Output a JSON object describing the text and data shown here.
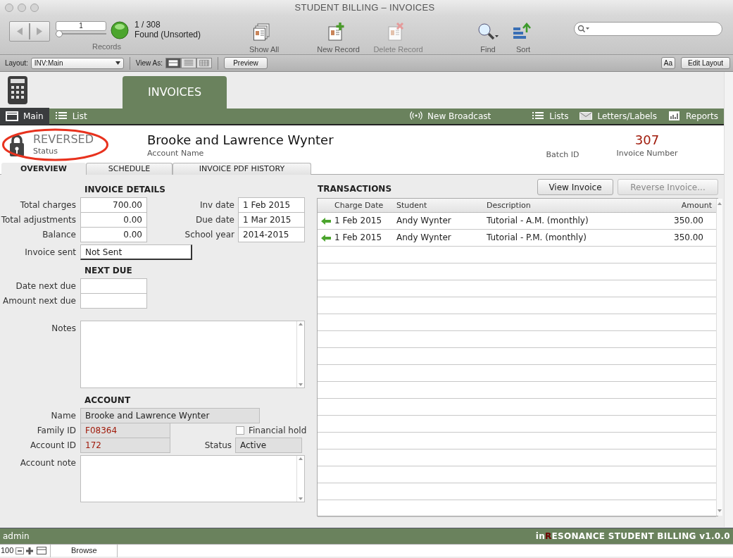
{
  "window": {
    "title": "STUDENT BILLING – INVOICES"
  },
  "toolbar": {
    "record_number": "1",
    "records_slider": {
      "level": 0
    },
    "found": "1 / 308",
    "found_status": "Found (Unsorted)",
    "records_label": "Records",
    "buttons": [
      {
        "kind": "show-all",
        "label": "Show All",
        "disabled": false
      },
      {
        "kind": "new-record",
        "label": "New Record",
        "disabled": false
      },
      {
        "kind": "delete-record",
        "label": "Delete Record",
        "disabled": true
      },
      {
        "kind": "find",
        "label": "Find",
        "disabled": false
      },
      {
        "kind": "sort",
        "label": "Sort",
        "disabled": false
      }
    ]
  },
  "layout_bar": {
    "layout_label": "Layout:",
    "layout_value": "INV:Main",
    "view_as_label": "View As:",
    "view_modes": [
      {
        "kind": "form",
        "selected": true
      },
      {
        "kind": "list",
        "selected": false
      },
      {
        "kind": "table",
        "selected": false
      }
    ],
    "preview": "Preview",
    "font_button": "Aa",
    "edit_layout": "Edit Layout"
  },
  "module_tab": "INVOICES",
  "nav": {
    "left": [
      {
        "kind": "window",
        "label": "Main",
        "selected": true
      },
      {
        "kind": "list",
        "label": "List",
        "selected": false
      }
    ],
    "right": [
      {
        "kind": "broadcast",
        "label": "New Broadcast"
      },
      {
        "kind": "list",
        "label": "Lists"
      },
      {
        "kind": "envelope",
        "label": "Letters/Labels"
      },
      {
        "kind": "chart",
        "label": "Reports"
      }
    ]
  },
  "record": {
    "locked": true,
    "status": "REVERSED",
    "status_label": "Status",
    "circled": true,
    "account_name": "Brooke and Lawrence Wynter",
    "account_name_label": "Account Name",
    "batch_id_label": "Batch ID",
    "invoice_number": "307",
    "invoice_number_label": "Invoice Number"
  },
  "tabs": [
    {
      "label": "OVERVIEW",
      "selected": true
    },
    {
      "label": "SCHEDULE",
      "selected": false
    },
    {
      "label": "INVOICE PDF HISTORY",
      "selected": false
    }
  ],
  "invoice_details": {
    "heading": "INVOICE DETAILS",
    "left_fields": [
      {
        "label": "Total charges",
        "value": "700.00"
      },
      {
        "label": "Total adjustments",
        "value": "0.00"
      },
      {
        "label": "Balance",
        "value": "0.00"
      }
    ],
    "right_fields": [
      {
        "label": "Inv date",
        "value": "1 Feb 2015"
      },
      {
        "label": "Due date",
        "value": "1 Mar 2015"
      },
      {
        "label": "School year",
        "value": "2014-2015"
      }
    ],
    "invoice_sent": {
      "label": "Invoice sent",
      "value": "Not Sent"
    }
  },
  "next_due": {
    "heading": "NEXT DUE",
    "fields": [
      {
        "label": "Date next due"
      },
      {
        "label": "Amount next due"
      }
    ]
  },
  "notes": {
    "label": "Notes"
  },
  "account": {
    "heading": "ACCOUNT",
    "name": {
      "label": "Name",
      "value": "Brooke and Lawrence Wynter"
    },
    "family_id": {
      "label": "Family ID",
      "value": "F08364"
    },
    "financial_hold": {
      "label": "Financial hold",
      "checked": false
    },
    "account_id": {
      "label": "Account ID",
      "value": "172"
    },
    "status": {
      "label": "Status",
      "value": "Active"
    },
    "account_note": {
      "label": "Account note"
    }
  },
  "transactions": {
    "heading": "TRANSACTIONS",
    "buttons": [
      {
        "label": "View Invoice",
        "disabled": false
      },
      {
        "label": "Reverse Invoice...",
        "disabled": true
      }
    ],
    "columns": [
      "Charge Date",
      "Student",
      "Description",
      "Amount"
    ],
    "rows": [
      {
        "charge_date": "1 Feb 2015",
        "student": "Andy Wynter",
        "description": "Tutorial - A.M. (monthly)",
        "amount": "350.00"
      },
      {
        "charge_date": "1 Feb 2015",
        "student": "Andy Wynter",
        "description": "Tutorial - P.M. (monthly)",
        "amount": "350.00"
      }
    ]
  },
  "status_bar": {
    "user": "admin",
    "brand": [
      {
        "text": "in",
        "accent": false
      },
      {
        "text": "R",
        "accent": true
      },
      {
        "text": "ESONANCE STUDENT BILLING v1.0.0",
        "accent": false
      }
    ]
  },
  "bottom_bar": {
    "zoom": "100",
    "mode": "Browse"
  }
}
